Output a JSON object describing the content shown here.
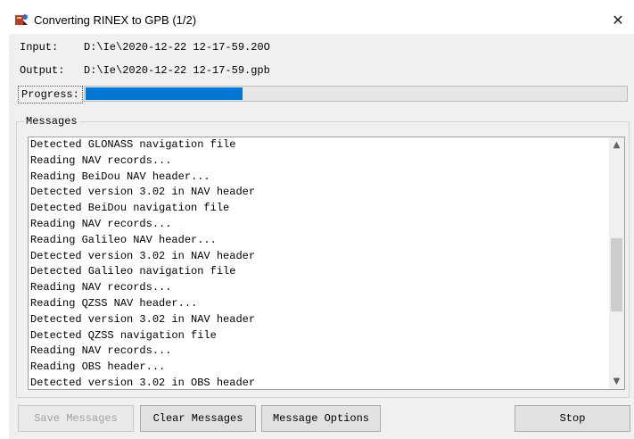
{
  "window": {
    "title": "Converting RINEX to GPB (1/2)",
    "close_glyph": "✕"
  },
  "fields": {
    "input_label": "Input:",
    "input_value": "D:\\Ie\\2020-12-22 12-17-59.20O",
    "output_label": "Output:",
    "output_value": "D:\\Ie\\2020-12-22 12-17-59.gpb",
    "progress_label": "Progress:"
  },
  "progress": {
    "fraction": 0.29
  },
  "messages": {
    "group_label": "Messages",
    "lines": [
      "Detected GLONASS navigation file",
      "Reading NAV records...",
      "Reading BeiDou NAV header...",
      "Detected version 3.02 in NAV header",
      "Detected BeiDou navigation file",
      "Reading NAV records...",
      "Reading Galileo NAV header...",
      "Detected version 3.02 in NAV header",
      "Detected Galileo navigation file",
      "Reading NAV records...",
      "Reading QZSS NAV header...",
      "Detected version 3.02 in NAV header",
      "Detected QZSS navigation file",
      "Reading NAV records...",
      "Reading OBS header...",
      "Detected version 3.02 in OBS header"
    ],
    "scroll_position": 0.58,
    "scroll_visible_fraction": 0.33
  },
  "buttons": {
    "save": "Save Messages",
    "clear": "Clear Messages",
    "options": "Message Options",
    "stop": "Stop"
  },
  "icons": {
    "app": "rinex-converter-icon",
    "scroll_up": "▲",
    "scroll_down": "▼"
  },
  "colors": {
    "progress_fill": "#0078d7",
    "scroll_thumb": "#cdcdcd"
  }
}
